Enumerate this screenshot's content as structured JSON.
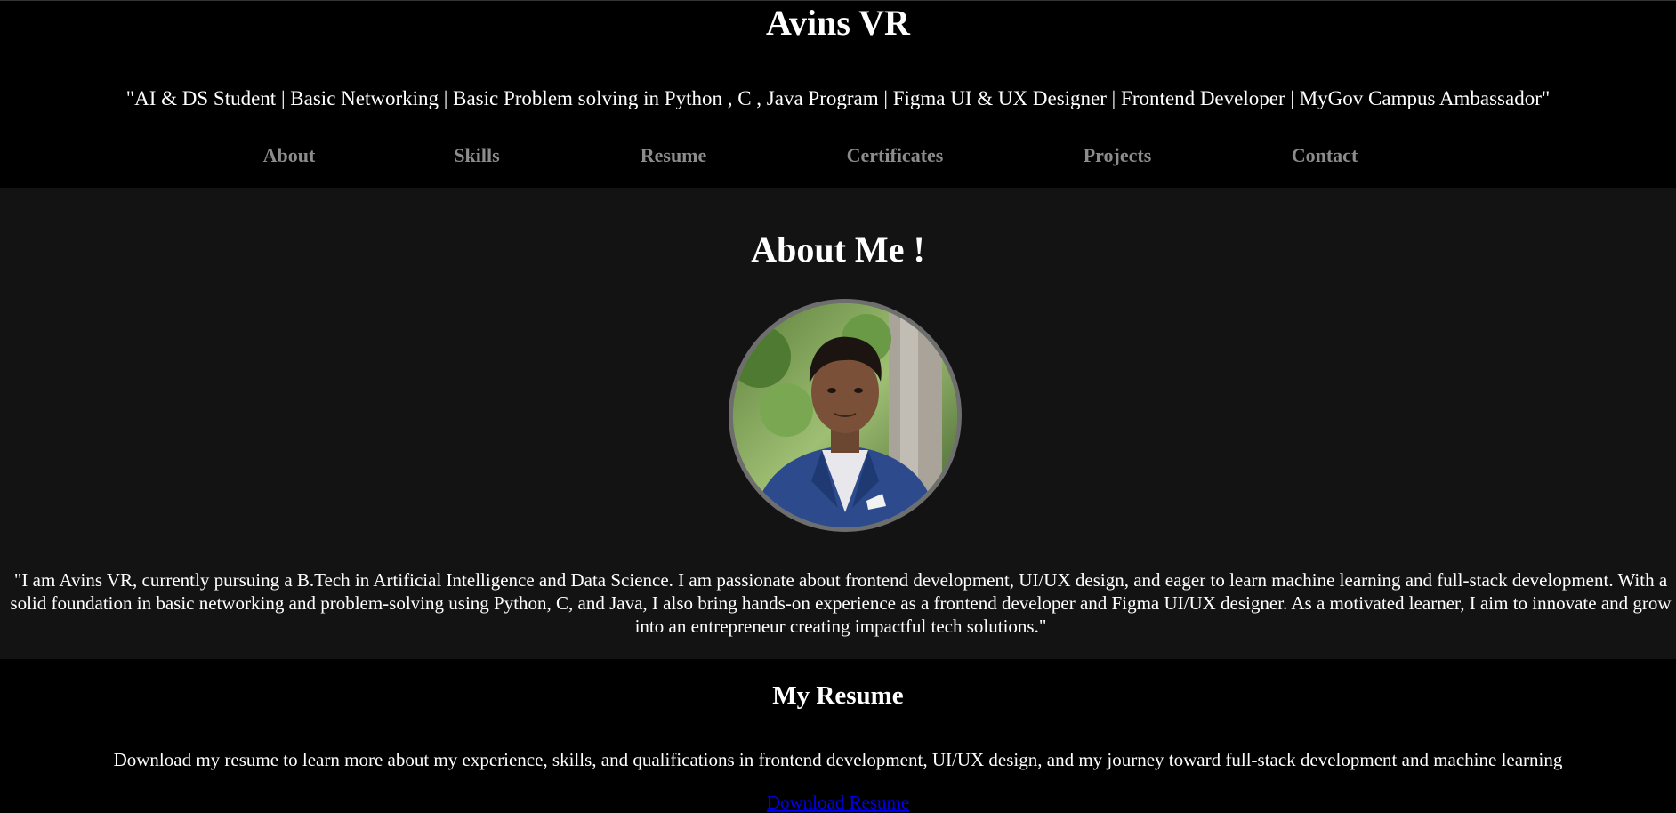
{
  "header": {
    "title": "Avins VR",
    "tagline": "\"AI & DS Student | Basic Networking | Basic Problem solving in Python , C , Java Program | Figma UI & UX Designer | Frontend Developer | MyGov Campus Ambassador\""
  },
  "nav": {
    "items": [
      {
        "label": "About"
      },
      {
        "label": "Skills"
      },
      {
        "label": "Resume"
      },
      {
        "label": "Certificates"
      },
      {
        "label": "Projects"
      },
      {
        "label": "Contact"
      }
    ]
  },
  "about": {
    "heading": "About Me !",
    "text": "\"I am Avins VR, currently pursuing a B.Tech in Artificial Intelligence and Data Science. I am passionate about frontend development, UI/UX design, and eager to learn machine learning and full-stack development. With a solid foundation in basic networking and problem-solving using Python, C, and Java, I also bring hands-on experience as a frontend developer and Figma UI/UX designer. As a motivated learner, I aim to innovate and grow into an entrepreneur creating impactful tech solutions.\""
  },
  "resume": {
    "heading": "My Resume",
    "description": "Download my resume to learn more about my experience, skills, and qualifications in frontend development, UI/UX design, and my journey toward full-stack development and machine learning",
    "download_label": "Download Resume"
  },
  "colors": {
    "header_bg": "#000000",
    "about_bg": "#131313",
    "nav_link": "#8c8c8c",
    "link_blue": "#0000ee",
    "avatar_border": "#6e6e6e"
  }
}
